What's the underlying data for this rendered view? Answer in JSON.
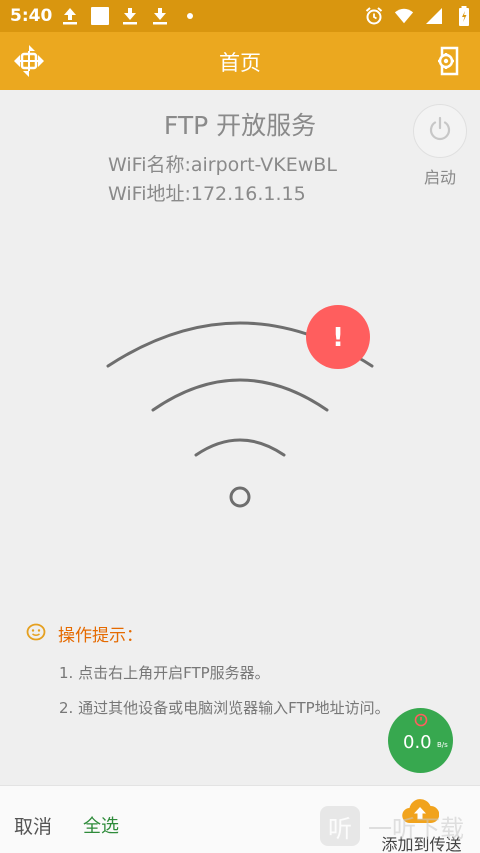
{
  "status_bar": {
    "time": "5:40",
    "icons_left": [
      "upload-icon",
      "square-notification-icon",
      "download-icon",
      "download-icon",
      "dot-icon"
    ],
    "icons_right": [
      "alarm-icon",
      "wifi-icon",
      "signal-icon",
      "battery-icon"
    ]
  },
  "app_bar": {
    "title": "首页",
    "left_icon": "ftp-logo-icon",
    "right_icon": "device-settings-icon",
    "color": "#eba81f"
  },
  "server": {
    "title": "FTP 开放服务",
    "wifi_name_label": "WiFi名称:",
    "wifi_name_value": "airport-VKEwBL",
    "wifi_addr_label": "WiFi地址:",
    "wifi_addr_value": "172.16.1.15",
    "start_label": "启动",
    "status_alert": "!",
    "alert_color": "#ff5e5e"
  },
  "tips": {
    "title": "操作提示：",
    "items": [
      "1. 点击右上角开启FTP服务器。",
      "2. 通过其他设备或电脑浏览器输入FTP地址访问。"
    ]
  },
  "speed": {
    "value": "0.0",
    "unit": "B/s",
    "color": "#37a84f"
  },
  "bottom_bar": {
    "cancel": "取消",
    "select_all": "全选",
    "add_to_transfer": "添加到传送"
  },
  "watermark": {
    "logo_text": "听",
    "text": "一听下载"
  }
}
